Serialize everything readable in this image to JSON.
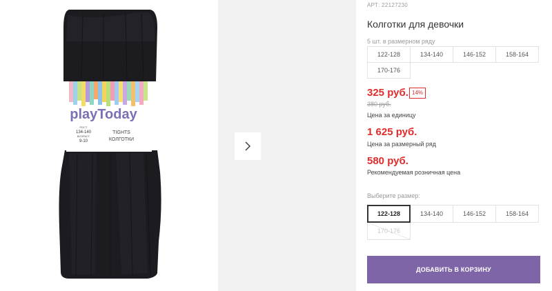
{
  "product": {
    "sku": "АРТ: 22127230",
    "title": "Колготки для девочки",
    "pack_note": "5 шт. в размерном ряду",
    "pack_sizes": [
      "122-128",
      "134-140",
      "146-152",
      "158-164",
      "170-176"
    ]
  },
  "pricing": {
    "unit_price": "325 руб.",
    "discount": "14%",
    "old_price": "380 руб.",
    "unit_label": "Цена за единицу",
    "row_price": "1 625 руб.",
    "row_label": "Цена за размерный ряд",
    "rrp_price": "580 руб.",
    "rrp_label": "Рекомендуемая розничная цена",
    "accent_color": "#e02b2b"
  },
  "size_select": {
    "label": "Выберите размер:",
    "options": [
      {
        "label": "122-128",
        "state": "selected"
      },
      {
        "label": "134-140",
        "state": "available"
      },
      {
        "label": "146-152",
        "state": "available"
      },
      {
        "label": "158-164",
        "state": "available"
      },
      {
        "label": "170-176",
        "state": "disabled"
      }
    ]
  },
  "cart": {
    "add_label": "ДОБАВИТЬ В КОРЗИНУ",
    "button_color": "#7e65a8"
  },
  "gallery": {
    "next_icon": "chevron-right-icon",
    "packaging": {
      "brand": "playToday",
      "label_en": "TIGHTS",
      "label_ru": "КОЛГОТКИ",
      "size_caption": "РОСТ",
      "size_height": "134-140",
      "size_age_caption": "ВОЗРАСТ",
      "size_age": "9-10"
    }
  }
}
